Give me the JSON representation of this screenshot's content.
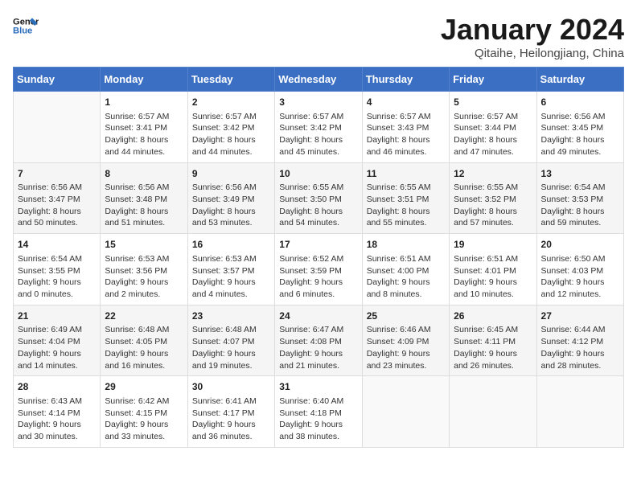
{
  "header": {
    "logo_line1": "General",
    "logo_line2": "Blue",
    "month": "January 2024",
    "location": "Qitaihe, Heilongjiang, China"
  },
  "weekdays": [
    "Sunday",
    "Monday",
    "Tuesday",
    "Wednesday",
    "Thursday",
    "Friday",
    "Saturday"
  ],
  "weeks": [
    [
      {
        "day": "",
        "content": ""
      },
      {
        "day": "1",
        "content": "Sunrise: 6:57 AM\nSunset: 3:41 PM\nDaylight: 8 hours\nand 44 minutes."
      },
      {
        "day": "2",
        "content": "Sunrise: 6:57 AM\nSunset: 3:42 PM\nDaylight: 8 hours\nand 44 minutes."
      },
      {
        "day": "3",
        "content": "Sunrise: 6:57 AM\nSunset: 3:42 PM\nDaylight: 8 hours\nand 45 minutes."
      },
      {
        "day": "4",
        "content": "Sunrise: 6:57 AM\nSunset: 3:43 PM\nDaylight: 8 hours\nand 46 minutes."
      },
      {
        "day": "5",
        "content": "Sunrise: 6:57 AM\nSunset: 3:44 PM\nDaylight: 8 hours\nand 47 minutes."
      },
      {
        "day": "6",
        "content": "Sunrise: 6:56 AM\nSunset: 3:45 PM\nDaylight: 8 hours\nand 49 minutes."
      }
    ],
    [
      {
        "day": "7",
        "content": "Sunrise: 6:56 AM\nSunset: 3:47 PM\nDaylight: 8 hours\nand 50 minutes."
      },
      {
        "day": "8",
        "content": "Sunrise: 6:56 AM\nSunset: 3:48 PM\nDaylight: 8 hours\nand 51 minutes."
      },
      {
        "day": "9",
        "content": "Sunrise: 6:56 AM\nSunset: 3:49 PM\nDaylight: 8 hours\nand 53 minutes."
      },
      {
        "day": "10",
        "content": "Sunrise: 6:55 AM\nSunset: 3:50 PM\nDaylight: 8 hours\nand 54 minutes."
      },
      {
        "day": "11",
        "content": "Sunrise: 6:55 AM\nSunset: 3:51 PM\nDaylight: 8 hours\nand 55 minutes."
      },
      {
        "day": "12",
        "content": "Sunrise: 6:55 AM\nSunset: 3:52 PM\nDaylight: 8 hours\nand 57 minutes."
      },
      {
        "day": "13",
        "content": "Sunrise: 6:54 AM\nSunset: 3:53 PM\nDaylight: 8 hours\nand 59 minutes."
      }
    ],
    [
      {
        "day": "14",
        "content": "Sunrise: 6:54 AM\nSunset: 3:55 PM\nDaylight: 9 hours\nand 0 minutes."
      },
      {
        "day": "15",
        "content": "Sunrise: 6:53 AM\nSunset: 3:56 PM\nDaylight: 9 hours\nand 2 minutes."
      },
      {
        "day": "16",
        "content": "Sunrise: 6:53 AM\nSunset: 3:57 PM\nDaylight: 9 hours\nand 4 minutes."
      },
      {
        "day": "17",
        "content": "Sunrise: 6:52 AM\nSunset: 3:59 PM\nDaylight: 9 hours\nand 6 minutes."
      },
      {
        "day": "18",
        "content": "Sunrise: 6:51 AM\nSunset: 4:00 PM\nDaylight: 9 hours\nand 8 minutes."
      },
      {
        "day": "19",
        "content": "Sunrise: 6:51 AM\nSunset: 4:01 PM\nDaylight: 9 hours\nand 10 minutes."
      },
      {
        "day": "20",
        "content": "Sunrise: 6:50 AM\nSunset: 4:03 PM\nDaylight: 9 hours\nand 12 minutes."
      }
    ],
    [
      {
        "day": "21",
        "content": "Sunrise: 6:49 AM\nSunset: 4:04 PM\nDaylight: 9 hours\nand 14 minutes."
      },
      {
        "day": "22",
        "content": "Sunrise: 6:48 AM\nSunset: 4:05 PM\nDaylight: 9 hours\nand 16 minutes."
      },
      {
        "day": "23",
        "content": "Sunrise: 6:48 AM\nSunset: 4:07 PM\nDaylight: 9 hours\nand 19 minutes."
      },
      {
        "day": "24",
        "content": "Sunrise: 6:47 AM\nSunset: 4:08 PM\nDaylight: 9 hours\nand 21 minutes."
      },
      {
        "day": "25",
        "content": "Sunrise: 6:46 AM\nSunset: 4:09 PM\nDaylight: 9 hours\nand 23 minutes."
      },
      {
        "day": "26",
        "content": "Sunrise: 6:45 AM\nSunset: 4:11 PM\nDaylight: 9 hours\nand 26 minutes."
      },
      {
        "day": "27",
        "content": "Sunrise: 6:44 AM\nSunset: 4:12 PM\nDaylight: 9 hours\nand 28 minutes."
      }
    ],
    [
      {
        "day": "28",
        "content": "Sunrise: 6:43 AM\nSunset: 4:14 PM\nDaylight: 9 hours\nand 30 minutes."
      },
      {
        "day": "29",
        "content": "Sunrise: 6:42 AM\nSunset: 4:15 PM\nDaylight: 9 hours\nand 33 minutes."
      },
      {
        "day": "30",
        "content": "Sunrise: 6:41 AM\nSunset: 4:17 PM\nDaylight: 9 hours\nand 36 minutes."
      },
      {
        "day": "31",
        "content": "Sunrise: 6:40 AM\nSunset: 4:18 PM\nDaylight: 9 hours\nand 38 minutes."
      },
      {
        "day": "",
        "content": ""
      },
      {
        "day": "",
        "content": ""
      },
      {
        "day": "",
        "content": ""
      }
    ]
  ]
}
